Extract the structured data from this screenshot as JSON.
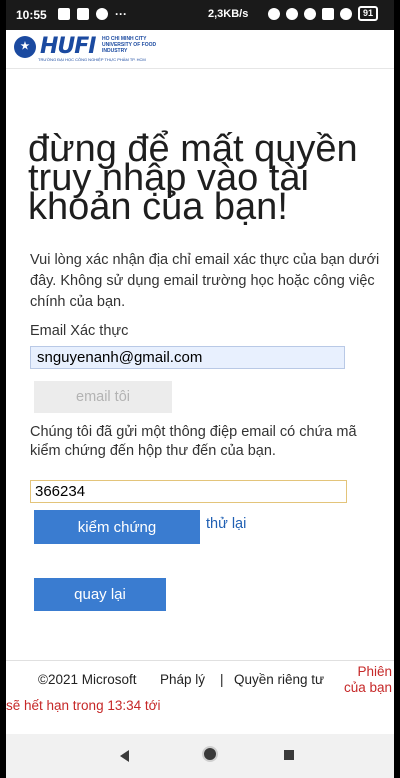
{
  "status_bar": {
    "time": "10:55",
    "extra": "···",
    "network_speed": "2,3KB/s",
    "battery": "91"
  },
  "header": {
    "logo_text": "HUFI",
    "logo_sub": "HO CHI MINH CITY UNIVERSITY OF FOOD INDUSTRY",
    "logo_tagline": "TRƯỜNG ĐẠI HỌC CÔNG NGHIỆP THỰC PHẨM TP. HCM"
  },
  "main": {
    "headline": "đừng để mất quyền truy nhập vào tài khoản của bạn!",
    "description": "Vui lòng xác nhận địa chỉ email xác thực của bạn dưới đây. Không sử dụng email trường học hoặc công việc chính của bạn.",
    "email_label": "Email Xác thực",
    "email_value": "snguyenanh@gmail.com",
    "email_me_button": "email tôi",
    "sent_message": "Chúng tôi đã gửi một thông điệp email có chứa mã kiểm chứng đến hộp thư đến của bạn.",
    "code_value": "366234",
    "verify_button": "kiểm chứng",
    "retry_link": "thử lại",
    "back_button": "quay lại"
  },
  "footer": {
    "copyright": "©2021 Microsoft",
    "legal": "Pháp lý",
    "separator": "|",
    "privacy": "Quyền riêng tư",
    "session_part1": "Phiên của bạn",
    "session_part2": "sẽ hết hạn trong 13:34 tới"
  },
  "colors": {
    "primary_button": "#3a7cd0",
    "session_text": "#c62828",
    "logo_blue": "#1b4aa0"
  }
}
